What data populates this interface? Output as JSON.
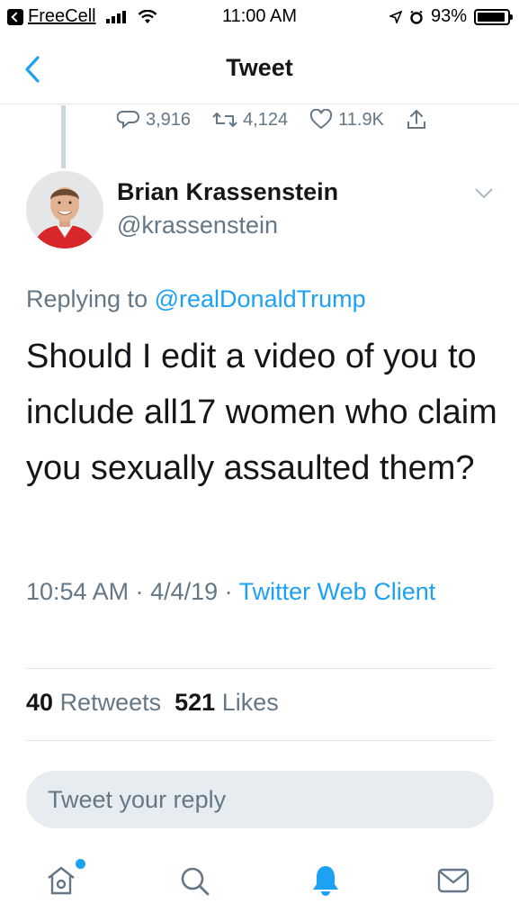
{
  "status_bar": {
    "carrier": "FreeCell",
    "time": "11:00 AM",
    "battery": "93%",
    "battery_level": 0.93
  },
  "nav": {
    "title": "Tweet",
    "back_icon": "chevron-left-icon"
  },
  "prev_tweet_actions": {
    "replies": "3,916",
    "retweets": "4,124",
    "likes": "11.9K"
  },
  "tweet": {
    "author_name": "Brian Krassenstein",
    "author_handle": "@krassenstein",
    "replying_prefix": "Replying to",
    "replying_to": "@realDonaldTrump",
    "text": "Should I edit a video of you to include all17 women who claim you sexually assaulted them?",
    "timestamp": "10:54 AM · 4/4/19 · ",
    "source": "Twitter Web Client",
    "retweets_count": "40",
    "retweets_label": "Retweets",
    "likes_count": "521",
    "likes_label": "Likes"
  },
  "reply": {
    "placeholder": "Tweet your reply"
  },
  "tabs": [
    "home-icon",
    "search-icon",
    "notifications-icon",
    "messages-icon"
  ],
  "colors": {
    "accent": "#1da1f2",
    "secondary_text": "#657786",
    "divider": "#e1e8ed",
    "reply_box": "#e6ecf0"
  }
}
